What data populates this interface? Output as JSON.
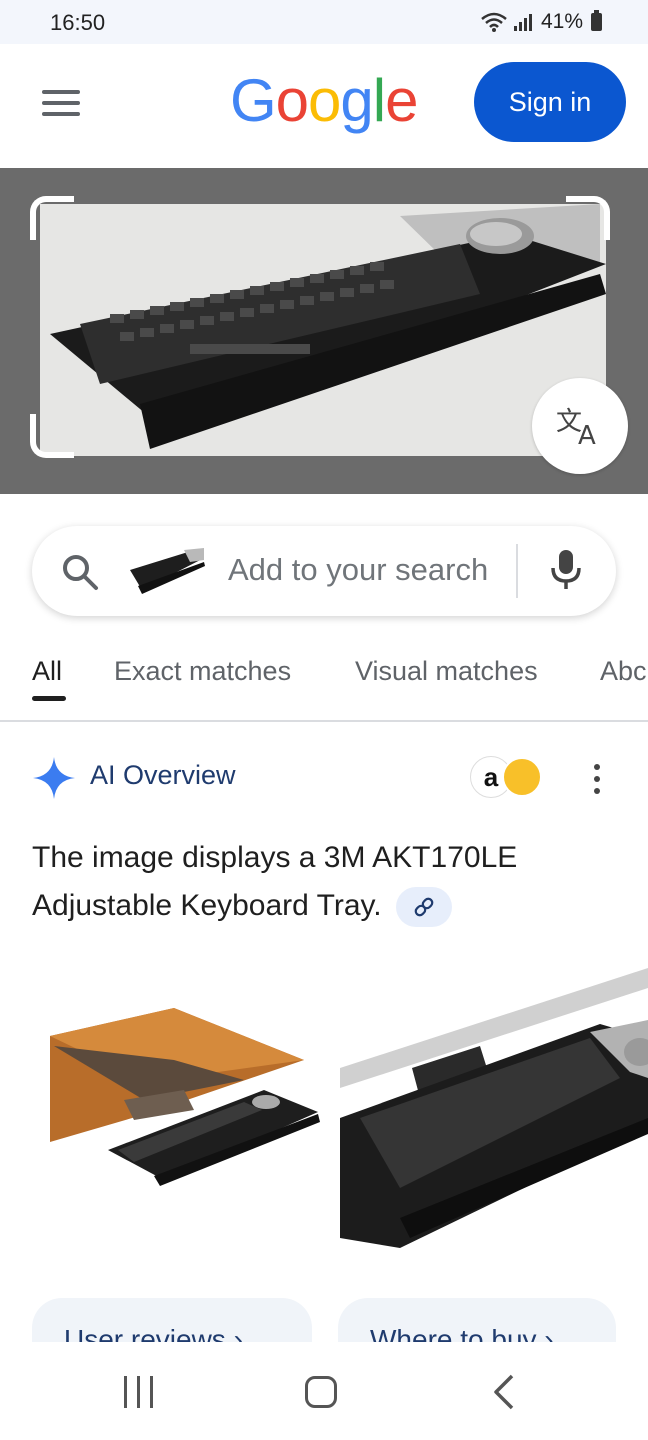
{
  "status_bar": {
    "time": "16:50",
    "battery": "41%"
  },
  "header": {
    "logo_text": "Google",
    "sign_in_label": "Sign in",
    "menu_icon": "hamburger-menu-icon"
  },
  "colors": {
    "google_blue": "#4285F4",
    "google_red": "#EA4335",
    "google_yellow": "#FBBC05",
    "google_green": "#34A853",
    "sign_in_button": "#0b57d0"
  },
  "search": {
    "placeholder": "Add to your search"
  },
  "tabs": [
    {
      "label": "All",
      "active": true
    },
    {
      "label": "Exact matches",
      "active": false
    },
    {
      "label": "Visual matches",
      "active": false
    },
    {
      "label": "Abc",
      "active": false
    }
  ],
  "ai_overview": {
    "title": "AI Overview",
    "text": "The image displays a 3M AKT170LE Adjustable Keyboard Tray.",
    "source_badge": "a"
  },
  "chips": [
    {
      "label": "User reviews"
    },
    {
      "label": "Where to buy"
    }
  ]
}
